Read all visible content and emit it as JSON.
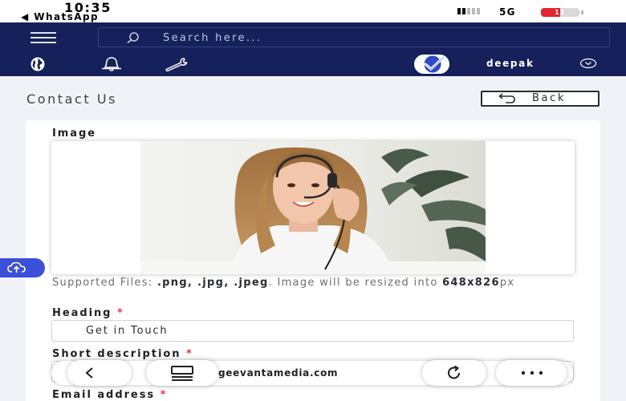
{
  "status_bar": {
    "time": "10:35",
    "back_app": "◀ WhatsApp",
    "network": "5G",
    "battery_level": "11",
    "battery_fraction": 0.11
  },
  "header": {
    "search_placeholder": "Search here...",
    "username": "deepak",
    "icons": [
      "menu-icon",
      "globe-icon",
      "bell-icon",
      "wrench-icon",
      "check-logo-icon",
      "chevron-down-icon"
    ]
  },
  "page": {
    "title": "Contact Us",
    "back_label": "Back"
  },
  "form": {
    "image_label": "Image",
    "hint_prefix": "Supported Files: ",
    "hint_formats": ".png, .jpg, .jpeg",
    "hint_middle": ". Image will be resized into ",
    "hint_size": "648x826",
    "hint_unit": "px",
    "heading_label": "Heading",
    "heading_value": "Get in Touch",
    "short_description_label": "Short description",
    "email_label": "Email address",
    "required_mark": "*"
  },
  "browser_bar": {
    "url": "geevantamedia.com",
    "icons": [
      "back-icon",
      "tabs-icon",
      "reload-icon",
      "more-icon"
    ]
  },
  "colors": {
    "header_bg": "#16205a",
    "accent": "#3b4fd8",
    "required": "#e53935"
  }
}
